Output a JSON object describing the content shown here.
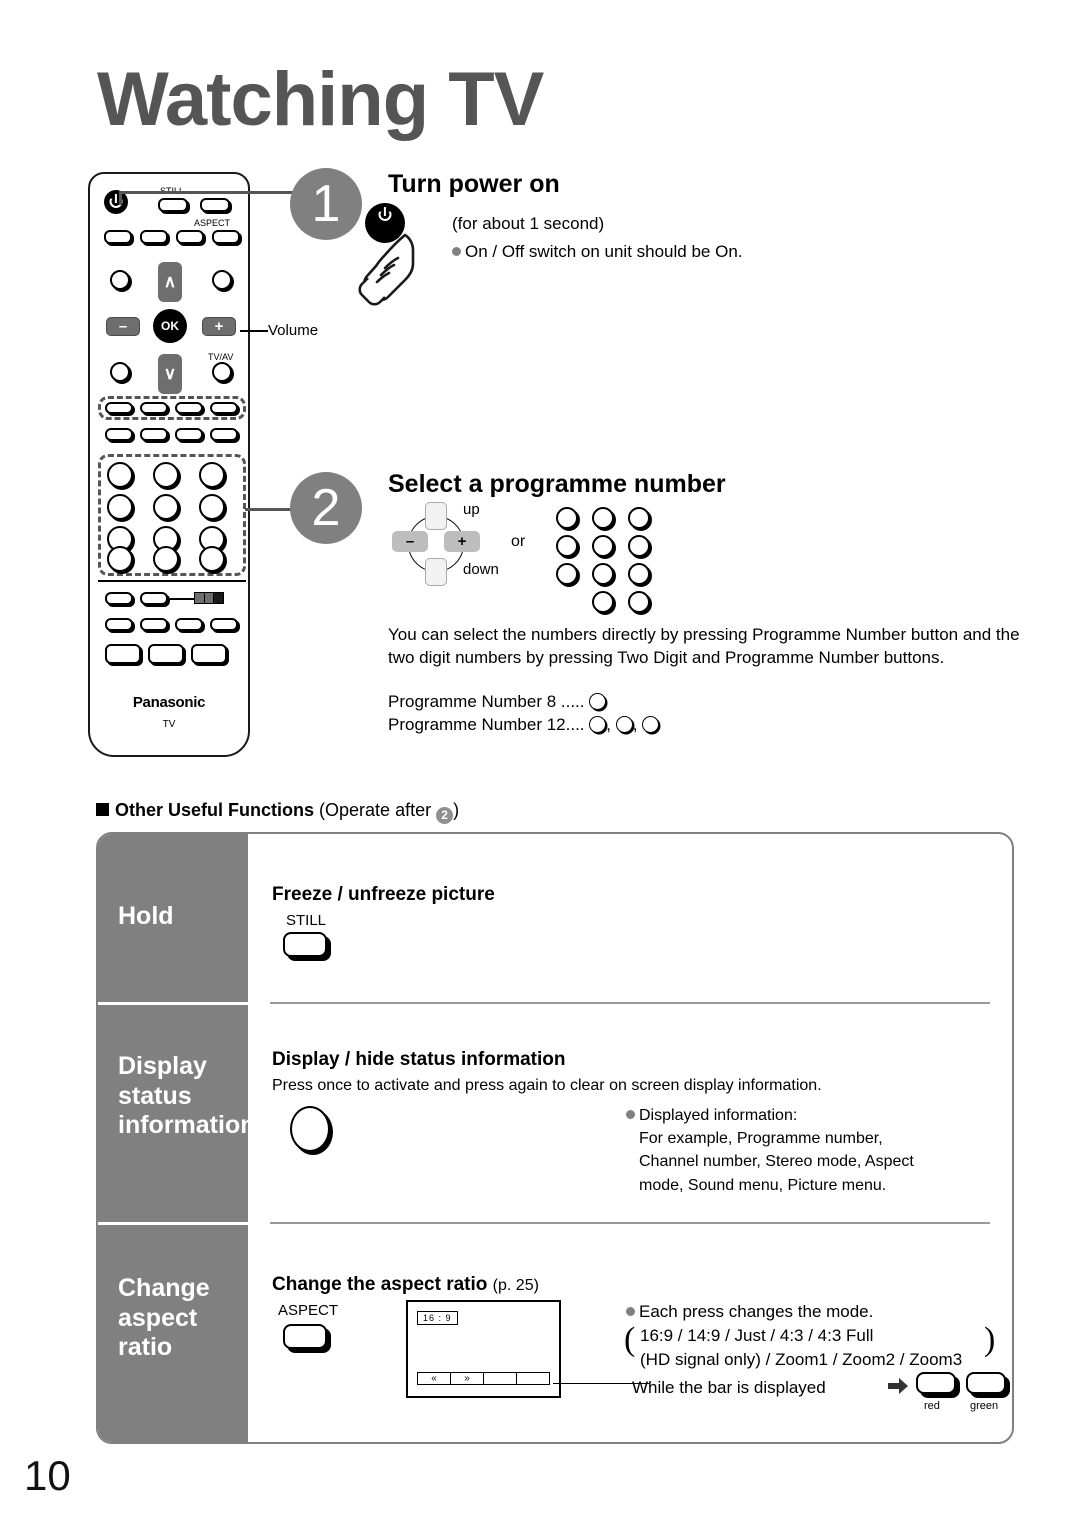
{
  "page": {
    "title": "Watching TV",
    "number": "10"
  },
  "remote": {
    "brand": "Panasonic",
    "brand_sub": "TV",
    "labels": {
      "still": "STILL",
      "aspect": "ASPECT",
      "tvav": "TV/AV",
      "ok": "OK",
      "minus": "–",
      "plus": "+",
      "up_chevron": "∧",
      "down_chevron": "∨"
    },
    "callouts": {
      "volume": "Volume"
    }
  },
  "steps": [
    {
      "number": "1",
      "heading": "Turn power on",
      "note": "(for about 1 second)",
      "bullet": "On / Off switch on unit should be On."
    },
    {
      "number": "2",
      "heading": "Select a programme number",
      "pad": {
        "up": "up",
        "down": "down",
        "minus": "–",
        "plus": "+"
      },
      "or": "or",
      "paragraph": "You can select the numbers directly by pressing Programme Number button and the two digit numbers by pressing Two Digit and Programme Number buttons.",
      "example_1": "Programme Number 8 .....",
      "example_2": "Programme Number 12...."
    }
  ],
  "other_useful_functions": {
    "heading": "Other Useful Functions",
    "heading_suffix_open": "(Operate after",
    "heading_badge": "2",
    "heading_suffix_close": ")",
    "rows": [
      {
        "side_label": "Hold",
        "title": "Freeze / unfreeze picture",
        "title_page": "",
        "key_cap": "STILL",
        "subtitle": "",
        "notes": []
      },
      {
        "side_label": "Display status information",
        "title": "Display / hide status information",
        "title_page": "",
        "key_cap": "",
        "subtitle": "Press once to activate and press again to clear on screen display information.",
        "notes": [
          "Displayed information:",
          "For example, Programme number,",
          "Channel number, Stereo mode, Aspect",
          "mode, Sound menu, Picture menu."
        ]
      },
      {
        "side_label": "Change aspect ratio",
        "title": "Change the aspect ratio",
        "title_page": "(p. 25)",
        "key_cap": "ASPECT",
        "subtitle": "",
        "notes": [
          "Each press changes the mode.",
          "16:9 / 14:9 / Just / 4:3 / 4:3 Full",
          "(HD signal only) / Zoom1 / Zoom2 / Zoom3",
          "While the bar is displayed"
        ],
        "tv_mock": {
          "ratio_label": "16 : 9",
          "bar_items": [
            "«",
            "»",
            "",
            ""
          ]
        },
        "colour_keys": [
          "red",
          "green"
        ]
      }
    ]
  },
  "colors": {
    "grey": "#808080",
    "title_grey": "#555555",
    "black": "#000000"
  }
}
